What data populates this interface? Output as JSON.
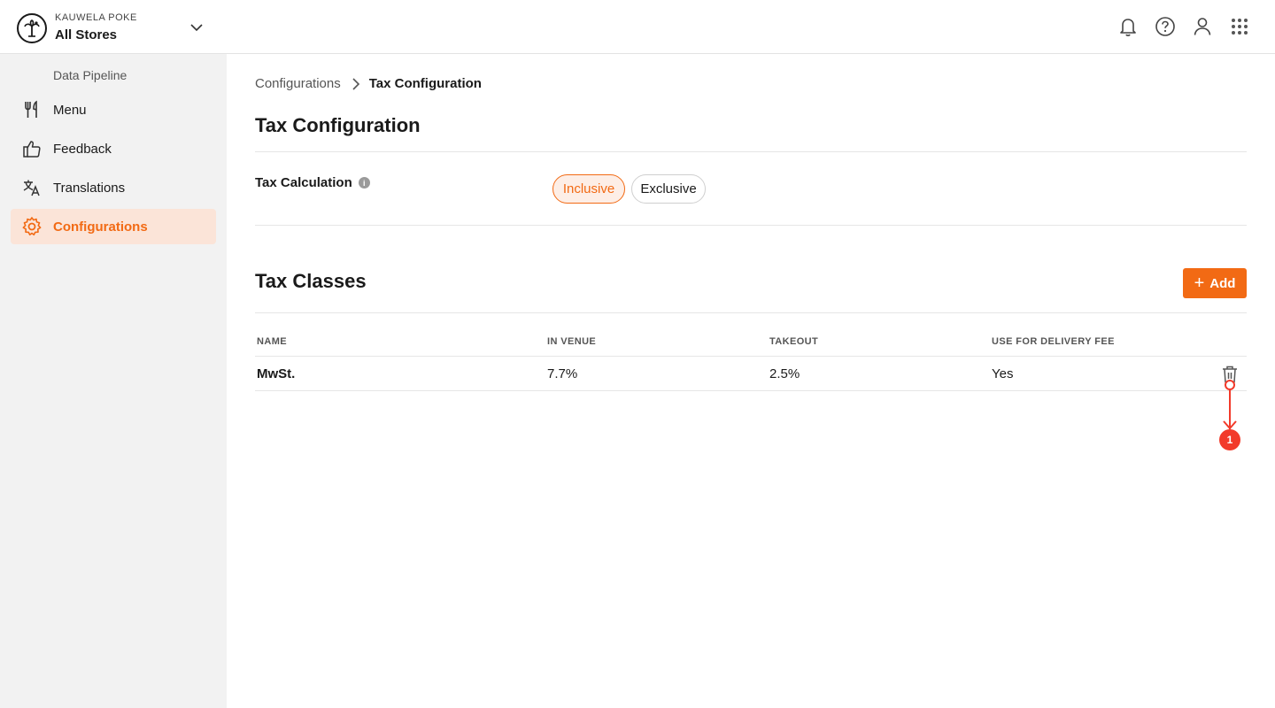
{
  "header": {
    "org_name": "KAUWELA POKE",
    "store_selector": "All Stores",
    "icons": [
      "bell-icon",
      "help-icon",
      "user-icon",
      "apps-grid-icon"
    ]
  },
  "sidebar": {
    "sub_item": "Data Pipeline",
    "items": [
      {
        "label": "Menu",
        "icon": "fork-knife-icon"
      },
      {
        "label": "Feedback",
        "icon": "thumbs-up-icon"
      },
      {
        "label": "Translations",
        "icon": "translate-icon"
      },
      {
        "label": "Configurations",
        "icon": "gear-icon",
        "active": true
      }
    ]
  },
  "breadcrumb": {
    "parent": "Configurations",
    "current": "Tax Configuration"
  },
  "page": {
    "title": "Tax Configuration",
    "tax_calculation": {
      "label": "Tax Calculation",
      "options": [
        "Inclusive",
        "Exclusive"
      ],
      "selected": "Inclusive"
    }
  },
  "tax_classes": {
    "title": "Tax Classes",
    "add_label": "Add",
    "columns": [
      "NAME",
      "IN VENUE",
      "TAKEOUT",
      "USE FOR DELIVERY FEE"
    ],
    "rows": [
      {
        "name": "MwSt.",
        "in_venue": "7.7%",
        "takeout": "2.5%",
        "delivery_fee": "Yes"
      }
    ]
  },
  "annotation": {
    "badge": "1"
  },
  "colors": {
    "accent": "#f26a14",
    "accent_bg": "#fbe4d8",
    "annotation": "#f23a2a"
  }
}
